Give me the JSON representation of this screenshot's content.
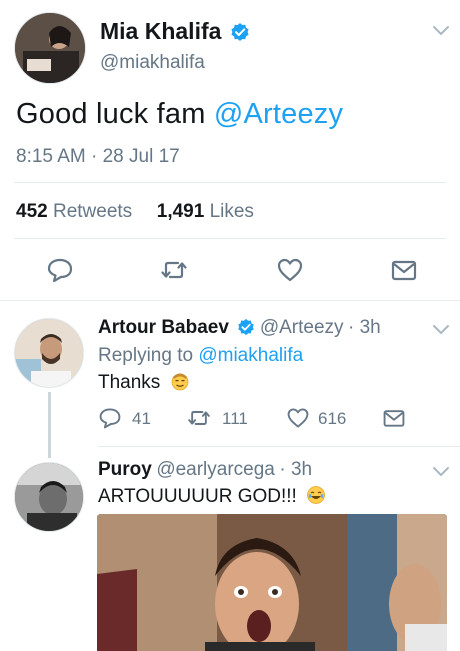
{
  "tweet": {
    "author_name": "Mia Khalifa",
    "author_handle": "@miakhalifa",
    "text": "Good luck fam ",
    "mention": "@Arteezy",
    "timestamp": "8:15 AM · 28 Jul 17",
    "retweets_count": "452",
    "retweets_label": "Retweets",
    "likes_count": "1,491",
    "likes_label": "Likes"
  },
  "replies": [
    {
      "author_name": "Artour Babaev",
      "author_handle": "@Arteezy",
      "time": "· 3h",
      "replying_prefix": "Replying to ",
      "replying_to": "@miakhalifa",
      "text": "Thanks",
      "reply_count": "41",
      "retweet_count": "111",
      "like_count": "616"
    },
    {
      "author_name": "Puroy",
      "author_handle": "@earlyarcega",
      "time": "· 3h",
      "text": "ARTOUUUUUR GOD!!!"
    }
  ],
  "colors": {
    "link": "#1da1f2",
    "secondary_text": "#657786",
    "divider": "#e6ecf0",
    "verified": "#1da1f2"
  },
  "icons": [
    "verified-badge-icon",
    "chevron-down-icon",
    "reply-icon",
    "retweet-icon",
    "like-icon",
    "share-icon",
    "emoji-icon"
  ]
}
